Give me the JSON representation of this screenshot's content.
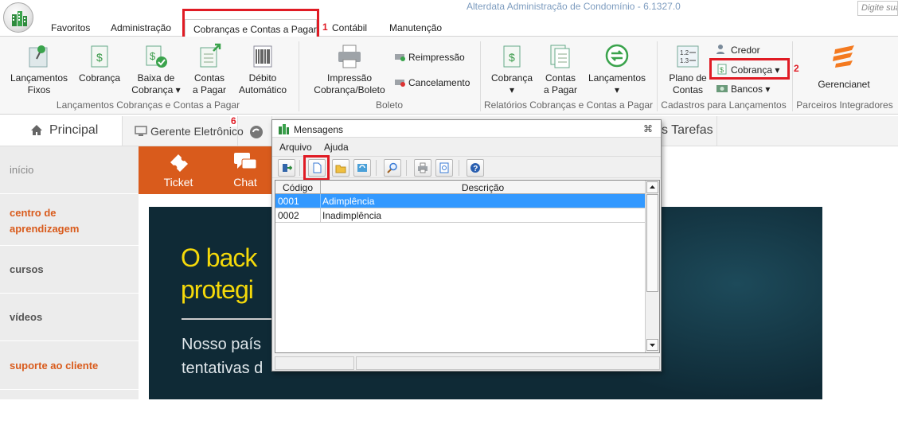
{
  "app": {
    "title": "Alterdata Administração de Condomínio - 6.1327.0",
    "search_placeholder": "Digite sua"
  },
  "menu": {
    "tabs": [
      "Favoritos",
      "Administração",
      "Cobranças e Contas a Pagar",
      "Contábil",
      "Manutenção"
    ],
    "annotation_1": "1"
  },
  "ribbon": {
    "g1": {
      "label": "Lançamentos Cobranças e Contas a Pagar",
      "buttons": [
        {
          "l1": "Lançamentos",
          "l2": "Fixos"
        },
        {
          "l1": "Cobrança",
          "l2": ""
        },
        {
          "l1": "Baixa de",
          "l2": "Cobrança ▾"
        },
        {
          "l1": "Contas",
          "l2": "a Pagar"
        },
        {
          "l1": "Débito",
          "l2": "Automático"
        }
      ]
    },
    "g2": {
      "label": "Boleto",
      "print_l1": "Impressão",
      "print_l2": "Cobrança/Boleto",
      "reprint": "Reimpressão",
      "cancel": "Cancelamento"
    },
    "g3": {
      "label": "Relatórios Cobranças e Contas a Pagar",
      "buttons": [
        {
          "l1": "Cobrança",
          "l2": "▾"
        },
        {
          "l1": "Contas",
          "l2": "a Pagar"
        },
        {
          "l1": "Lançamentos",
          "l2": "▾"
        }
      ]
    },
    "g4": {
      "label": "Cadastros para Lançamentos",
      "plano_l1": "Plano de",
      "plano_l2": "Contas",
      "credor": "Credor",
      "cobranca": "Cobrança ▾",
      "bancos": "Bancos ▾",
      "annotation_2": "2"
    },
    "g5": {
      "label": "Parceiros Integradores",
      "gerencianet": "Gerencianet"
    }
  },
  "tabs2": {
    "principal": "Principal",
    "gerente": "Gerente Eletrônico",
    "tarefas": "s Tarefas",
    "annotation_6": "6"
  },
  "sidebar": {
    "items": [
      "início",
      "centro de aprendizagem",
      "cursos",
      "vídeos",
      "suporte ao cliente"
    ]
  },
  "quicklinks": {
    "ticket": "Ticket",
    "chat": "Chat"
  },
  "banner": {
    "line1": "O back",
    "line2": "protegi",
    "line3": "Nosso país",
    "line4": "tentativas d"
  },
  "dialog": {
    "title": "Mensagens",
    "menu": [
      "Arquivo",
      "Ajuda"
    ],
    "columns": [
      "Código",
      "Descrição"
    ],
    "rows": [
      {
        "code": "0001",
        "desc": "Adimplência",
        "selected": true
      },
      {
        "code": "0002",
        "desc": "Inadimplência",
        "selected": false
      }
    ],
    "close": "⌘"
  },
  "colors": {
    "accent_red": "#e01b24",
    "orange": "#d95b1c",
    "selection": "#3399ff",
    "banner_bg": "#0f2a36",
    "banner_text": "#f5d90a"
  }
}
